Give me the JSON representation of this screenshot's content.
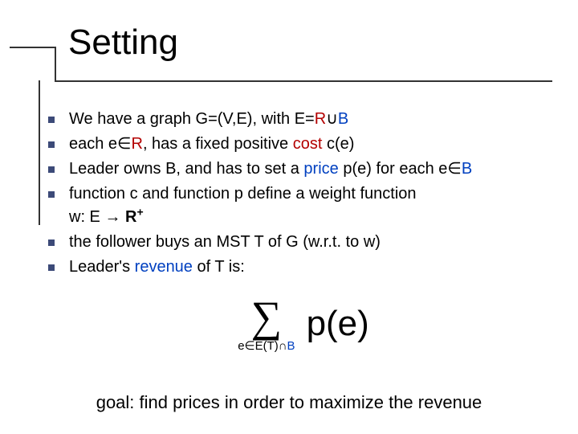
{
  "title": "Setting",
  "bullets": {
    "b1_pre": "We have a graph G=(V,E), with E=",
    "b1_R": "R",
    "b1_cup": "∪",
    "b1_B": "B",
    "b2_pre": "each e∈",
    "b2_R": "R",
    "b2_post": ", has a fixed positive ",
    "b2_cost": "cost",
    "b2_ce": " c(e)",
    "b3_pre": "Leader owns B, and has to set a ",
    "b3_price": "price",
    "b3_mid": " p(e) for each e∈",
    "b3_B": "B",
    "b4_l1_pre": "function c and function p define a ",
    "b4_l1_weight": "weight function",
    "b4_l2_pre": "w: E → ",
    "b4_l2_Rplus": "R",
    "b4_l2_plus": "+",
    "b5_pre": "the follower buys an ",
    "b5_mst": "MST",
    "b5_post": " T of G (w.r.t. to w)",
    "b6_pre": "Leader's ",
    "b6_rev": "revenue",
    "b6_post": " of T is:"
  },
  "formula": {
    "sigma": "∑",
    "sub_pre": "e∈E(T)∩",
    "sub_B": "B",
    "pe": "p(e)"
  },
  "goal": "goal: find prices in order to maximize the revenue"
}
